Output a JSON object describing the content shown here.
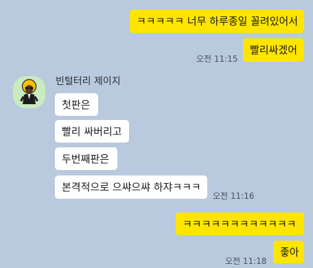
{
  "messages": {
    "out_1": "ㅋㅋㅋㅋㅋ 너무 하루종일 꼴려있어서",
    "out_2": "빨리싸겠어",
    "out_ts_1": "오전 11:15",
    "sender_name": "빈털터리 제이지",
    "in_1": "첫판은",
    "in_2": "빨리 싸버리고",
    "in_3": "두번째판은",
    "in_4": "본격적으로 으쌰으쌰 하쟈ㅋㅋㅋ",
    "in_ts": "오전 11:16",
    "out_3": "ㅋㅋㅋㅋㅋㅋㅋㅋㅋㅋㅋㅋ",
    "out_4": "좋아",
    "out_ts_2": "오전 11:18"
  },
  "colors": {
    "background": "#b9cadf",
    "outgoing_bubble": "#fee500",
    "incoming_bubble": "#ffffff",
    "avatar_background": "#c8ebc0"
  },
  "icons": {
    "avatar": "profile-avatar-character"
  }
}
